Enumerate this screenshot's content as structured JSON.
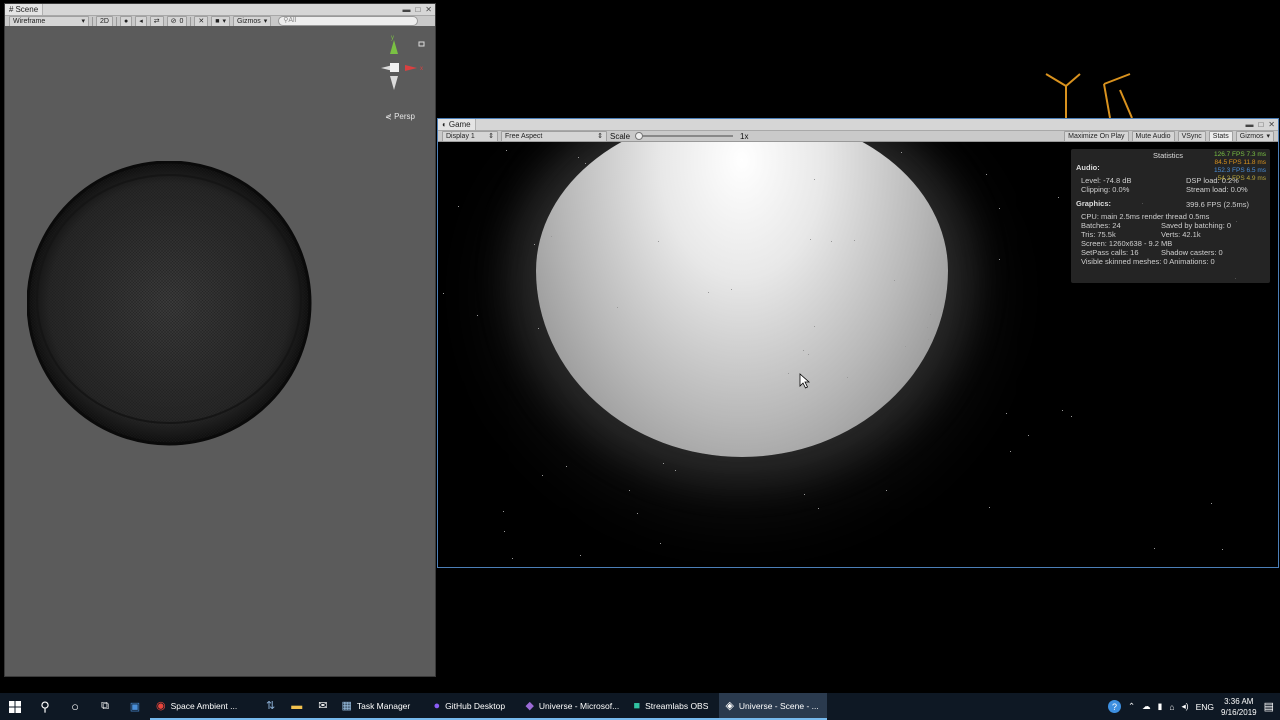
{
  "scene": {
    "tab_label": "Scene",
    "shading_mode": "Wireframe",
    "btn_2d": "2D",
    "hidden_count": "0",
    "gizmos_label": "Gizmos",
    "search_placeholder": "All",
    "persp_label": "Persp",
    "axis_x": "x",
    "axis_y": "y"
  },
  "game": {
    "tab_label": "Game",
    "display": "Display 1",
    "aspect": "Free Aspect",
    "scale_label": "Scale",
    "scale_value": "1x",
    "scale_fraction": 0.0,
    "maximize": "Maximize On Play",
    "mute": "Mute Audio",
    "vsync": "VSync",
    "stats_btn": "Stats",
    "gizmos": "Gizmos"
  },
  "stats": {
    "title": "Statistics",
    "audio_heading": "Audio:",
    "level": "Level: -74.8 dB",
    "clipping": "Clipping: 0.0%",
    "dsp": "DSP load: 0.2%",
    "stream": "Stream load: 0.0%",
    "graphics_heading": "Graphics:",
    "fps": "399.6 FPS (2.5ms)",
    "cpu": "CPU: main 2.5ms  render thread 0.5ms",
    "batches": "Batches: 24",
    "saved": "Saved by batching: 0",
    "tris": "Tris: 75.5k",
    "verts": "Verts: 42.1k",
    "screen": "Screen: 1260x638 - 9.2 MB",
    "setpass": "SetPass calls: 16",
    "shadow": "Shadow casters: 0",
    "skinned": "Visible skinned meshes: 0  Animations: 0"
  },
  "fps_overlay": [
    "126.7 FPS 7.3 ms",
    "84.5 FPS 11.8 ms",
    "152.3 FPS 6.5 ms",
    "54.2 FPS 4.9 ms"
  ],
  "taskbar": {
    "apps": [
      {
        "label": "Space Ambient ...",
        "icon": "chrome-icon",
        "active": false
      },
      {
        "label": "",
        "icon": "network-icon",
        "active": false
      },
      {
        "label": "",
        "icon": "folder-icon",
        "active": false
      },
      {
        "label": "",
        "icon": "mail-icon",
        "active": false
      },
      {
        "label": "Task Manager",
        "icon": "task-manager-icon",
        "active": false
      },
      {
        "label": "GitHub Desktop",
        "icon": "github-icon",
        "active": false
      },
      {
        "label": "Universe - Microsof...",
        "icon": "visual-studio-icon",
        "active": false
      },
      {
        "label": "Streamlabs OBS",
        "icon": "streamlabs-icon",
        "active": false
      },
      {
        "label": "Universe - Scene - ...",
        "icon": "unity-icon",
        "active": true
      }
    ],
    "lang": "ENG",
    "time": "3:36 AM",
    "date": "9/16/2019"
  },
  "colors": {
    "accent": "#76b9ed",
    "game_border": "#4c7fb8"
  }
}
